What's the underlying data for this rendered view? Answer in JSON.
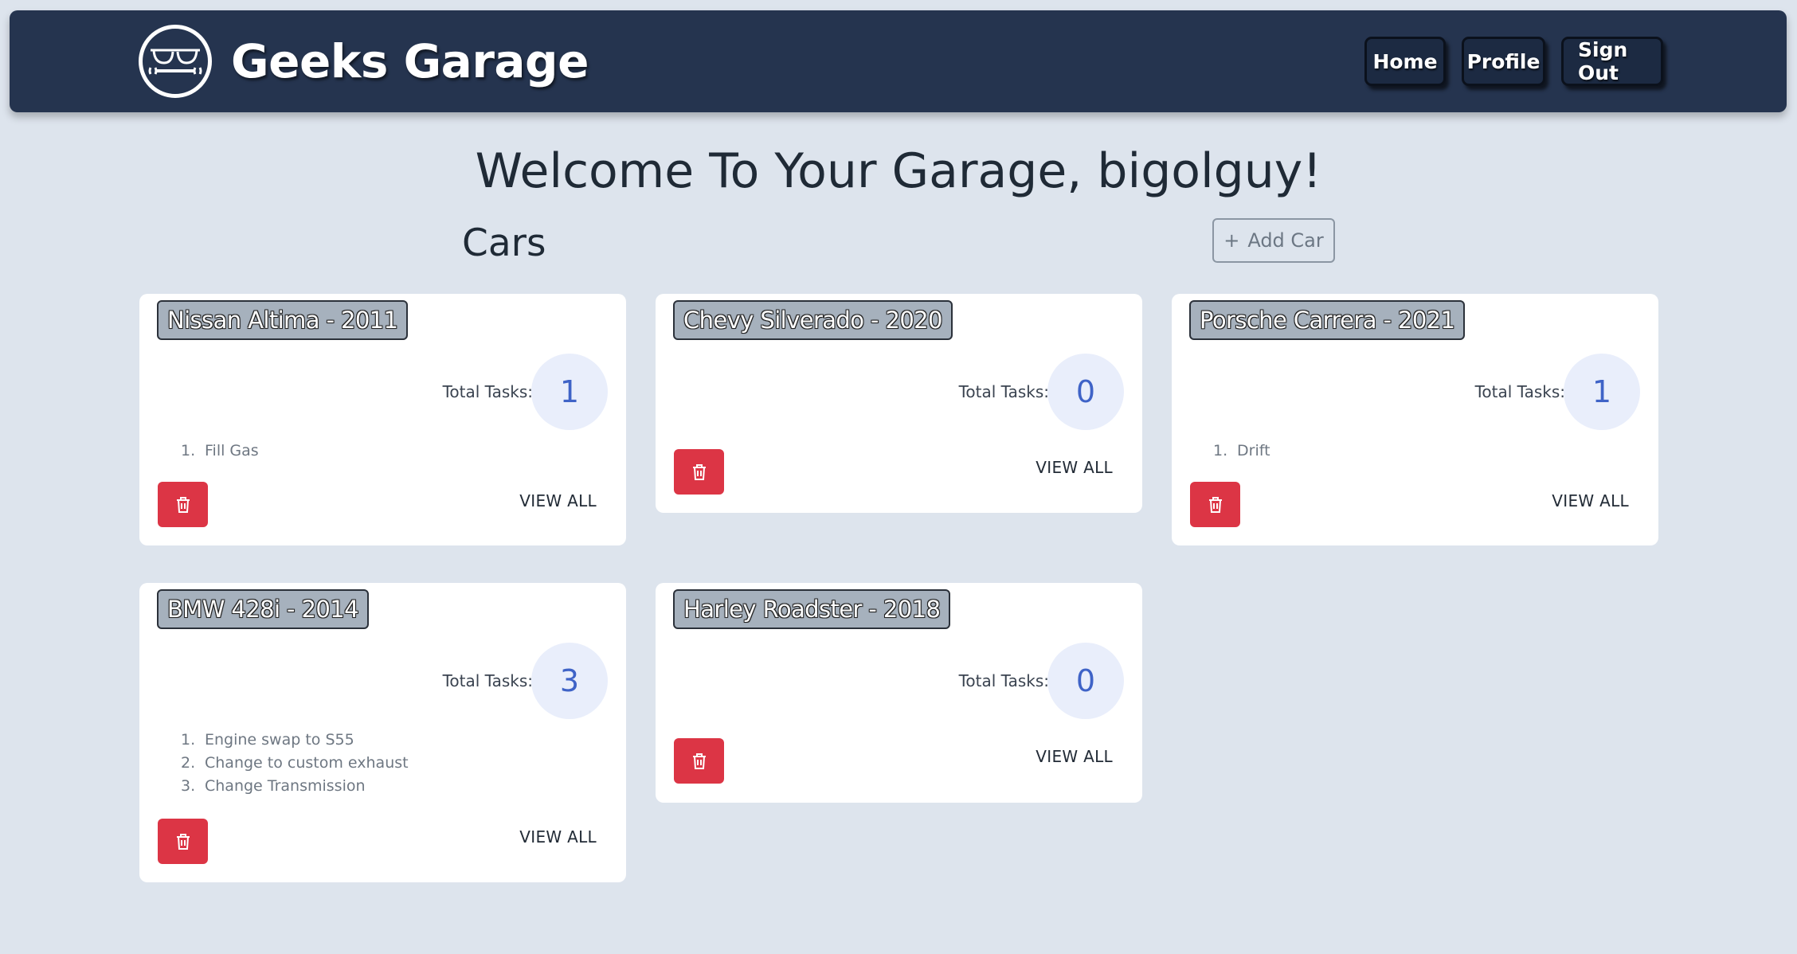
{
  "app": {
    "title": "Geeks Garage"
  },
  "nav": {
    "home": "Home",
    "profile": "Profile",
    "sign_out": "Sign Out"
  },
  "welcome": "Welcome To Your Garage, bigolguy!",
  "cars_heading": "Cars",
  "add_car": {
    "icon": "+",
    "label": "Add Car"
  },
  "labels": {
    "total_tasks": "Total Tasks:",
    "view_all": "VIEW ALL"
  },
  "cars": [
    {
      "name": "Nissan Altima - 2011",
      "total_tasks": "1",
      "tasks": [
        "Fill Gas"
      ]
    },
    {
      "name": "Chevy Silverado - 2020",
      "total_tasks": "0",
      "tasks": []
    },
    {
      "name": "Porsche Carrera - 2021",
      "total_tasks": "1",
      "tasks": [
        "Drift"
      ]
    },
    {
      "name": "BMW 428i - 2014",
      "total_tasks": "3",
      "tasks": [
        "Engine swap to S55",
        "Change to custom exhaust",
        "Change Transmission"
      ]
    },
    {
      "name": "Harley Roadster - 2018",
      "total_tasks": "0",
      "tasks": []
    }
  ],
  "colors": {
    "navbar": "#25344f",
    "background": "#dde4ed",
    "delete": "#dc3545",
    "count_text": "#3f63c7"
  },
  "icons": {
    "logo": "glasses-wrench-icon",
    "delete": "trash-icon"
  }
}
